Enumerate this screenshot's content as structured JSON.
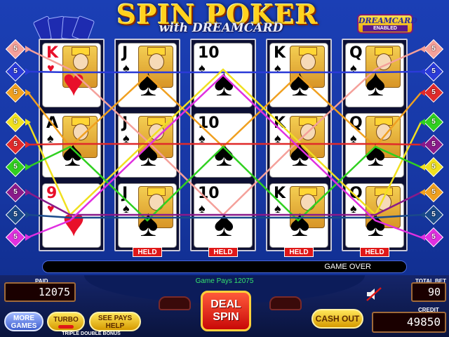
{
  "game": {
    "title": "SPIN POKER",
    "subtitle": "with DREAMCARD",
    "badge_top": "DREAMCARD",
    "badge_bottom": "ENABLED"
  },
  "reels": [
    {
      "cards": [
        {
          "rank": "K",
          "suit": "♥",
          "color": "red",
          "face": true
        },
        {
          "rank": "A",
          "suit": "♠",
          "color": "black",
          "face": true
        },
        {
          "rank": "9",
          "suit": "♥",
          "color": "red",
          "face": false
        }
      ],
      "held": false
    },
    {
      "cards": [
        {
          "rank": "J",
          "suit": "♠",
          "color": "black",
          "face": true
        },
        {
          "rank": "J",
          "suit": "♠",
          "color": "black",
          "face": true
        },
        {
          "rank": "J",
          "suit": "♠",
          "color": "black",
          "face": true
        }
      ],
      "held": true
    },
    {
      "cards": [
        {
          "rank": "10",
          "suit": "♠",
          "color": "black",
          "face": false
        },
        {
          "rank": "10",
          "suit": "♠",
          "color": "black",
          "face": false
        },
        {
          "rank": "10",
          "suit": "♠",
          "color": "black",
          "face": false
        }
      ],
      "held": true
    },
    {
      "cards": [
        {
          "rank": "K",
          "suit": "♠",
          "color": "black",
          "face": true
        },
        {
          "rank": "K",
          "suit": "♠",
          "color": "black",
          "face": true
        },
        {
          "rank": "K",
          "suit": "♠",
          "color": "black",
          "face": true
        }
      ],
      "held": true
    },
    {
      "cards": [
        {
          "rank": "Q",
          "suit": "♠",
          "color": "black",
          "face": true
        },
        {
          "rank": "Q",
          "suit": "♠",
          "color": "black",
          "face": true
        },
        {
          "rank": "Q",
          "suit": "♠",
          "color": "black",
          "face": true
        }
      ],
      "held": true
    }
  ],
  "held_label": "HELD",
  "line_markers_left": [
    {
      "num": "5",
      "color": "#f4a09a"
    },
    {
      "num": "5",
      "color": "#2a3ad8"
    },
    {
      "num": "5",
      "color": "#f0a020"
    },
    {
      "num": "5",
      "color": "#f0e020"
    },
    {
      "num": "5",
      "color": "#e02a2a"
    },
    {
      "num": "5",
      "color": "#30d020"
    },
    {
      "num": "5",
      "color": "#8a1a8a"
    },
    {
      "num": "5",
      "color": "#1a4a8a"
    },
    {
      "num": "5",
      "color": "#e030e0"
    }
  ],
  "line_markers_right": [
    {
      "num": "5",
      "color": "#f4a09a"
    },
    {
      "num": "5",
      "color": "#2a3ad8"
    },
    {
      "num": "5",
      "color": "#e02a2a"
    },
    {
      "num": "5",
      "color": "#30d020"
    },
    {
      "num": "5",
      "color": "#8a1a8a"
    },
    {
      "num": "5",
      "color": "#f0e020"
    },
    {
      "num": "5",
      "color": "#f0a020"
    },
    {
      "num": "5",
      "color": "#1a4a8a"
    },
    {
      "num": "5",
      "color": "#e030e0"
    }
  ],
  "status": {
    "message": "GAME OVER",
    "game_pays": "Game Pays 12075"
  },
  "meters": {
    "paid_label": "PAID",
    "paid": "12075",
    "total_bet_label": "TOTAL BET",
    "total_bet": "90",
    "credit_label": "CREDIT",
    "credit": "49850"
  },
  "buttons": {
    "more_games": "MORE GAMES",
    "turbo": "TURBO",
    "see_pays": "SEE PAYS HELP",
    "deal_spin": "DEAL SPIN",
    "cash_out": "CASH OUT",
    "game_name": "TRIPLE DOUBLE BONUS"
  }
}
